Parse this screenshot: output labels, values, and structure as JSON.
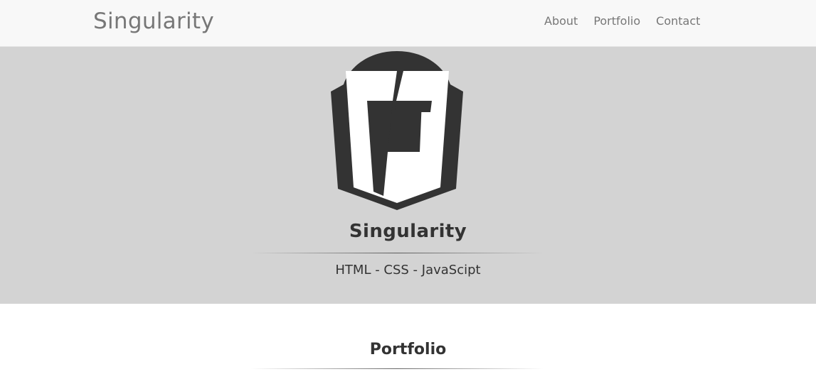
{
  "navbar": {
    "brand": "Singularity",
    "links": [
      "About",
      "Portfolio",
      "Contact"
    ]
  },
  "header": {
    "title": "Singularity",
    "subtitle": "HTML - CSS - JavaScipt"
  },
  "portfolio": {
    "title": "Portfolio"
  },
  "colors": {
    "navbar_bg": "#f8f8f8",
    "header_bg": "#d3d3d3",
    "logo_dark": "#333333",
    "text": "#333333",
    "nav_text": "#777777"
  },
  "icons": {
    "logo": "html5-style-shield-logo"
  }
}
